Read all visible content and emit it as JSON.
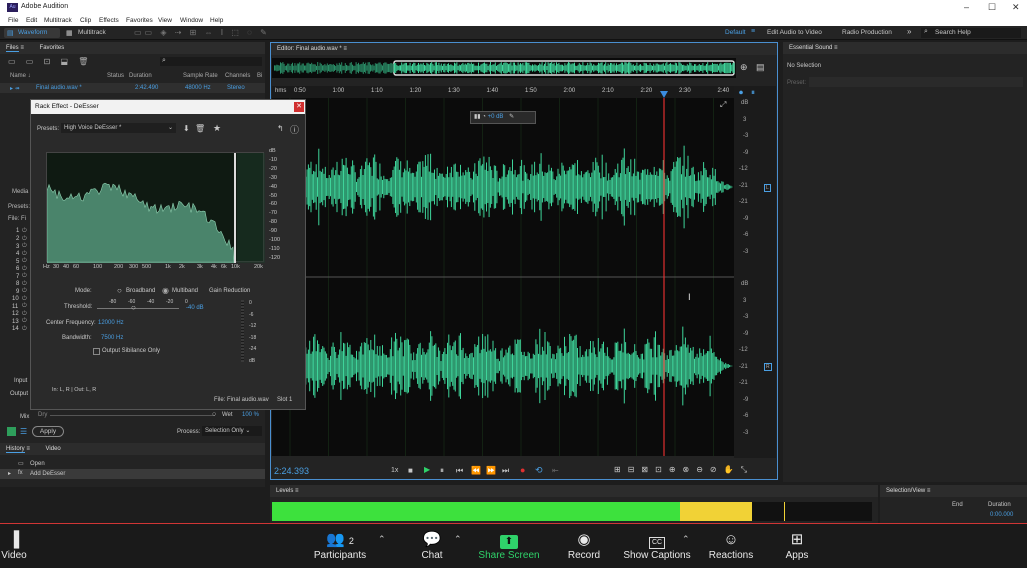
{
  "titlebar": {
    "logo": "Au",
    "title": "Adobe Audition",
    "minimize": "–",
    "maximize": "☐",
    "close": "✕"
  },
  "menu": [
    "File",
    "Edit",
    "Multitrack",
    "Clip",
    "Effects",
    "Favorites",
    "View",
    "Window",
    "Help"
  ],
  "toolbar": {
    "waveform": "Waveform",
    "multitrack": "Multitrack",
    "workspace": "Default",
    "edit_audio_video": "Edit Audio to Video",
    "radio_production": "Radio Production",
    "more": "»",
    "search": "Search Help"
  },
  "files": {
    "tab_files": "Files",
    "tab_favorites": "Favorites",
    "col_name": "Name ↓",
    "col_status": "Status",
    "col_duration": "Duration",
    "col_rate": "Sample Rate",
    "col_channels": "Channels",
    "col_bits": "Bi",
    "file_name": "Final audio.wav *",
    "file_duration": "2:42.490",
    "file_rate": "48000 Hz",
    "file_channels": "Stereo"
  },
  "editor": {
    "tab": "Editor: Final audio.wav *",
    "ruler_unit": "hms",
    "ruler": [
      "0:50",
      "1:00",
      "1:10",
      "1:20",
      "1:30",
      "1:40",
      "1:50",
      "2:00",
      "2:10",
      "2:20",
      "2:30",
      "2:40"
    ],
    "gain": "+0 dB",
    "timecode": "2:24.393",
    "speed": "1x"
  },
  "db_scale_top": [
    "dB",
    "3",
    "-3",
    "-9",
    "-12",
    "-21",
    "-21",
    "-9",
    "-6",
    "-3"
  ],
  "db_scale_bottom": [
    "dB",
    "3",
    "-3",
    "-9",
    "-12",
    "-21",
    "-21",
    "-9",
    "-6",
    "-3"
  ],
  "channel_labels": [
    "L",
    "R"
  ],
  "rack": {
    "title": "Rack Effect - DeEsser",
    "presets_label": "Presets:",
    "preset": "High Voice DeEsser *",
    "db_axis": [
      "dB",
      "-10",
      "-20",
      "-30",
      "-40",
      "-50",
      "-60",
      "-70",
      "-80",
      "-90",
      "-100",
      "-110",
      "-120"
    ],
    "freq_axis": [
      "Hz",
      "30",
      "40",
      "60",
      "100",
      "200",
      "300",
      "500",
      "1k",
      "2k",
      "3k",
      "4k",
      "6k",
      "10k",
      "20k"
    ],
    "mode_label": "Mode:",
    "broadband": "Broadband",
    "multiband": "Multiband",
    "gain_reduction": "Gain Reduction",
    "threshold_label": "Threshold:",
    "threshold_ticks": [
      "-80",
      "-60",
      "-40",
      "-20",
      "0"
    ],
    "threshold_value": "-40 dB",
    "center_label": "Center Frequency:",
    "center_value": "12000 Hz",
    "bandwidth_label": "Bandwidth:",
    "bandwidth_value": "7500 Hz",
    "output_sib": "Output Sibilance Only",
    "gr_scale": [
      "0",
      "-6",
      "-12",
      "-18",
      "-24",
      "dB"
    ],
    "file_label": "File: Final audio.wav",
    "slot": "Slot 1"
  },
  "left_side": {
    "media": "Media",
    "presets": "Presets:",
    "file_fi": "File: Fi",
    "tracks": [
      "1",
      "2",
      "3",
      "4",
      "5",
      "6",
      "7",
      "8",
      "9",
      "10",
      "11",
      "12",
      "13",
      "14"
    ],
    "input": "Input",
    "output": "Output",
    "io": "In: L, R | Out: L, R",
    "mix": "Mix",
    "dry": "Dry",
    "wet": "Wet",
    "wet_value": "100 %",
    "apply": "Apply",
    "process_label": "Process:",
    "process_value": "Selection Only"
  },
  "history": {
    "tab_history": "History",
    "tab_video": "Video",
    "items": [
      "Open",
      "Add DeEsser"
    ]
  },
  "essential": {
    "title": "Essential Sound",
    "status": "No Selection",
    "preset": "Preset:"
  },
  "levels": {
    "title": "Levels",
    "green_frac": 0.68,
    "yellow_frac": 0.12
  },
  "selview": {
    "title": "Selection/View",
    "end": "End",
    "duration": "Duration",
    "value": "0:00.000"
  },
  "zoom": {
    "video": "Video",
    "participants": "Participants",
    "participants_count": "2",
    "chat": "Chat",
    "share": "Share Screen",
    "record": "Record",
    "captions": "Show Captions",
    "reactions": "Reactions",
    "apps": "Apps"
  },
  "colors": {
    "accent": "#4a9fe3",
    "wave": "#3ed49a",
    "playhead": "#e03030",
    "share": "#2fd26a"
  }
}
